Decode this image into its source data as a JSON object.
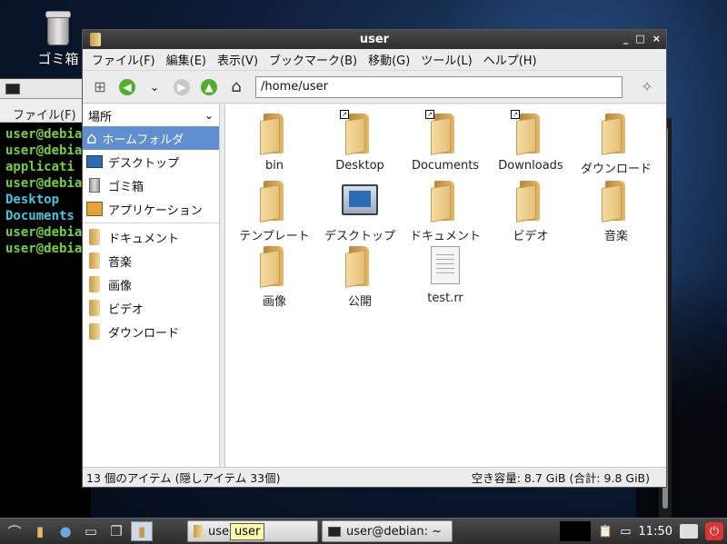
{
  "desktop": {
    "trash_label": "ゴミ箱"
  },
  "terminal": {
    "menu_label": "ファイル(F)",
    "lines": [
      {
        "text": "user@debia",
        "color": "green"
      },
      {
        "text": "user@debia",
        "color": "green"
      },
      {
        "text": "applicati",
        "color": "green"
      },
      {
        "text": "user@debia",
        "color": "green"
      },
      {
        "text": "Desktop",
        "color": "cyan"
      },
      {
        "text": "Documents",
        "color": "cyan"
      },
      {
        "text": "user@debia",
        "color": "green"
      },
      {
        "text": "user@debia",
        "color": "green"
      }
    ]
  },
  "window": {
    "title": "user",
    "buttons": [
      "_",
      "□",
      "×"
    ],
    "menu": [
      "ファイル(F)",
      "編集(E)",
      "表示(V)",
      "ブックマーク(B)",
      "移動(G)",
      "ツール(L)",
      "ヘルプ(H)"
    ],
    "path": "/home/user"
  },
  "sidebar": {
    "header": "場所",
    "places": [
      {
        "label": "ホームフォルダ",
        "icon": "home-icon",
        "selected": true
      },
      {
        "label": "デスクトップ",
        "icon": "desktop-icon",
        "selected": false
      },
      {
        "label": "ゴミ箱",
        "icon": "trash-icon",
        "selected": false
      },
      {
        "label": "アプリケーション",
        "icon": "applications-icon",
        "selected": false
      }
    ],
    "bookmarks": [
      {
        "label": "ドキュメント"
      },
      {
        "label": "音楽"
      },
      {
        "label": "画像"
      },
      {
        "label": "ビデオ"
      },
      {
        "label": "ダウンロード"
      }
    ]
  },
  "files": [
    {
      "name": "bin",
      "type": "folder",
      "link": false
    },
    {
      "name": "Desktop",
      "type": "folder",
      "link": true
    },
    {
      "name": "Documents",
      "type": "folder",
      "link": true
    },
    {
      "name": "Downloads",
      "type": "folder",
      "link": true
    },
    {
      "name": "ダウンロード",
      "type": "folder",
      "link": false
    },
    {
      "name": "テンプレート",
      "type": "folder",
      "link": false
    },
    {
      "name": "デスクトップ",
      "type": "desktop",
      "link": false
    },
    {
      "name": "ドキュメント",
      "type": "folder",
      "link": false
    },
    {
      "name": "ビデオ",
      "type": "folder",
      "link": false
    },
    {
      "name": "音楽",
      "type": "folder",
      "link": false
    },
    {
      "name": "画像",
      "type": "folder",
      "link": false
    },
    {
      "name": "公開",
      "type": "folder",
      "link": false
    },
    {
      "name": "test.rr",
      "type": "file",
      "link": false
    }
  ],
  "status": {
    "left": "13 個のアイテム (隠しアイテム 33個)",
    "right": "空き容量: 8.7 GiB (合計: 9.8 GiB)"
  },
  "taskbar": {
    "fm_task": "user",
    "tooltip": "user",
    "terminal_task": "user@debian: ~",
    "clock": "11:50"
  }
}
